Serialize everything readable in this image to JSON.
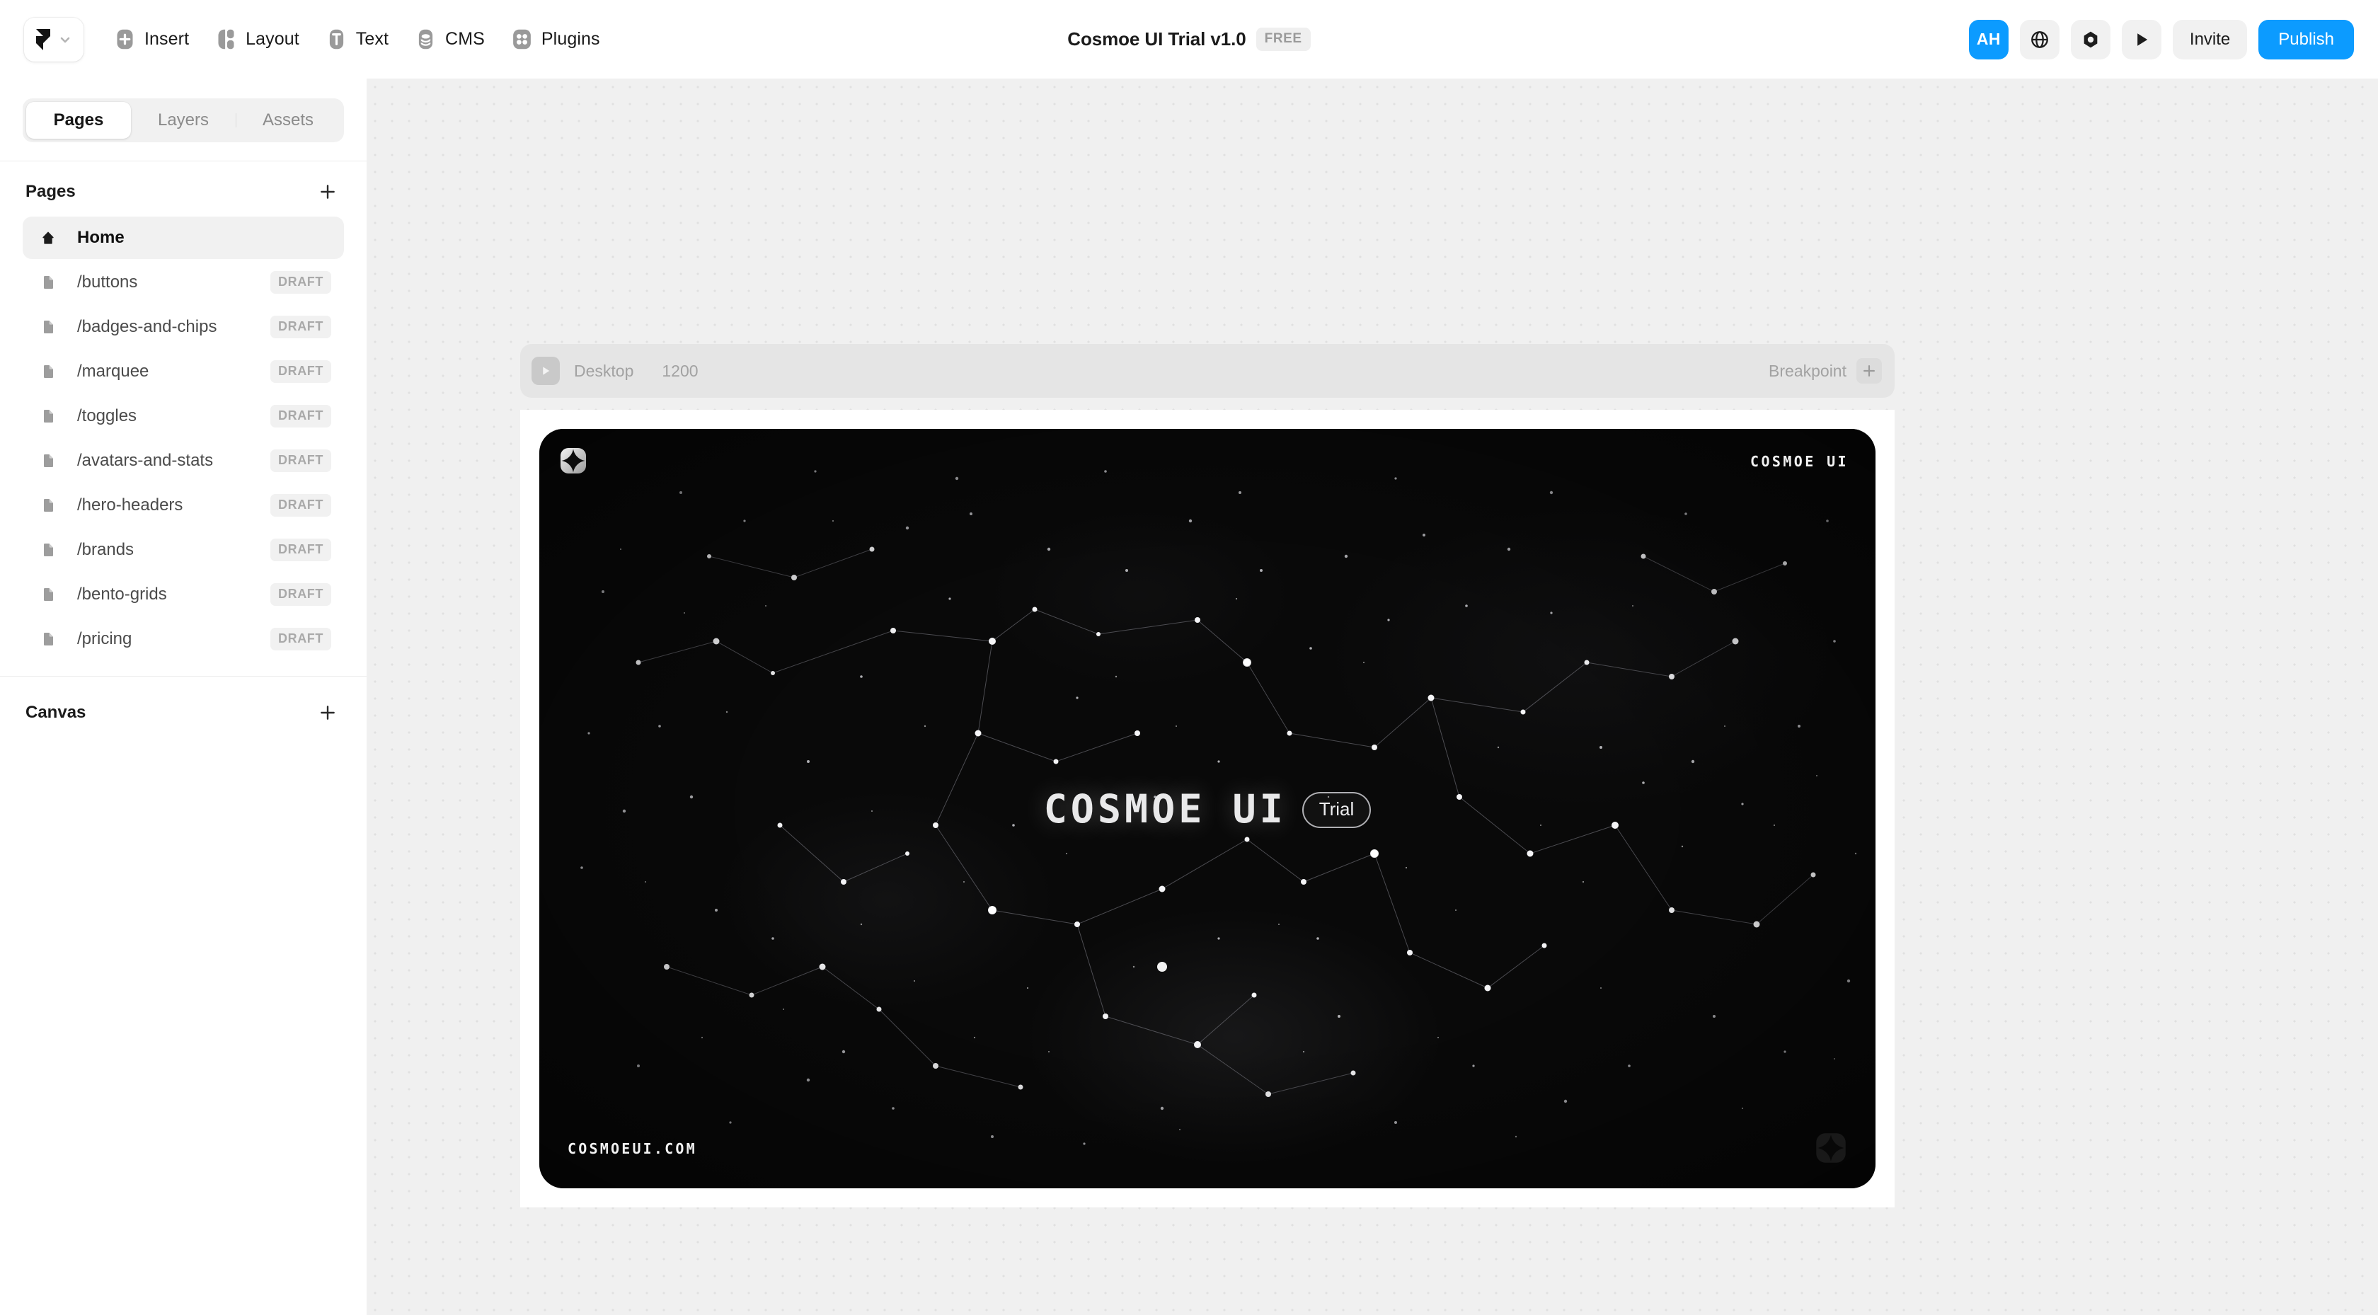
{
  "topbar": {
    "logo_button": {
      "icon": "framer-logo-icon",
      "chevron": "chevron-down-icon"
    },
    "menu": [
      {
        "label": "Insert",
        "icon": "plus-square-icon"
      },
      {
        "label": "Layout",
        "icon": "layout-columns-icon"
      },
      {
        "label": "Text",
        "icon": "text-t-icon"
      },
      {
        "label": "CMS",
        "icon": "database-icon"
      },
      {
        "label": "Plugins",
        "icon": "plugins-grid-icon"
      }
    ],
    "title": "Cosmoe UI Trial v1.0",
    "plan_badge": "FREE",
    "avatar_initials": "AH",
    "actions": [
      {
        "name": "globe-icon",
        "label": ""
      },
      {
        "name": "diamond-icon",
        "label": ""
      },
      {
        "name": "play-icon",
        "label": ""
      }
    ],
    "invite_label": "Invite",
    "publish_label": "Publish",
    "accent_color": "#0c9bff"
  },
  "sidebar": {
    "tabs": [
      {
        "label": "Pages",
        "active": true
      },
      {
        "label": "Layers",
        "active": false
      },
      {
        "label": "Assets",
        "active": false
      }
    ],
    "pages_section": {
      "title": "Pages",
      "add_label": "+"
    },
    "pages": [
      {
        "label": "Home",
        "icon": "home-icon",
        "badge": "",
        "active": true
      },
      {
        "label": "/buttons",
        "icon": "page-icon",
        "badge": "DRAFT",
        "active": false
      },
      {
        "label": "/badges-and-chips",
        "icon": "page-icon",
        "badge": "DRAFT",
        "active": false
      },
      {
        "label": "/marquee",
        "icon": "page-icon",
        "badge": "DRAFT",
        "active": false
      },
      {
        "label": "/toggles",
        "icon": "page-icon",
        "badge": "DRAFT",
        "active": false
      },
      {
        "label": "/avatars-and-stats",
        "icon": "page-icon",
        "badge": "DRAFT",
        "active": false
      },
      {
        "label": "/hero-headers",
        "icon": "page-icon",
        "badge": "DRAFT",
        "active": false
      },
      {
        "label": "/brands",
        "icon": "page-icon",
        "badge": "DRAFT",
        "active": false
      },
      {
        "label": "/bento-grids",
        "icon": "page-icon",
        "badge": "DRAFT",
        "active": false
      },
      {
        "label": "/pricing",
        "icon": "page-icon",
        "badge": "DRAFT",
        "active": false
      }
    ],
    "canvas_section": {
      "title": "Canvas",
      "add_label": "+"
    }
  },
  "canvas": {
    "breakpoint": {
      "name": "Desktop",
      "width": "1200",
      "right_label": "Breakpoint",
      "add_label": "+"
    },
    "hero": {
      "logo_icon": "sparkle-square-logo-icon",
      "wordmark_top_right": "COSMOE UI",
      "title": "COSMOE UI",
      "title_badge": "Trial",
      "domain": "COSMOEUI.COM",
      "corner_logo_icon": "sparkle-square-logo-icon",
      "background_color": "#090909"
    }
  }
}
